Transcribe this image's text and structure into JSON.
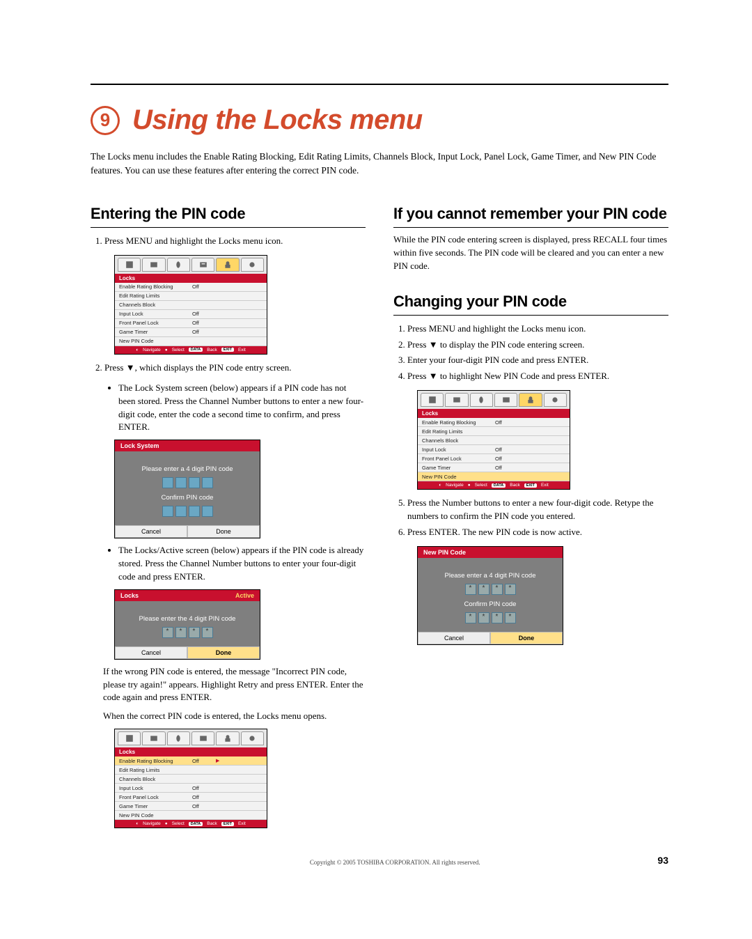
{
  "chapter": {
    "number": "9",
    "title": "Using the Locks menu"
  },
  "intro": "The Locks menu includes the Enable Rating Blocking, Edit Rating Limits, Channels Block, Input Lock, Panel Lock, Game Timer, and New PIN Code features. You can use these features after entering the correct PIN code.",
  "left": {
    "h1": "Entering the PIN code",
    "step1": "Press MENU and highlight the Locks menu icon.",
    "step2": "Press ▼, which displays the PIN code entry screen.",
    "bullet1": "The Lock System screen (below) appears if a PIN code has not been stored. Press the Channel Number buttons to enter a new four-digit code, enter the code a second time to confirm, and press ENTER.",
    "bullet2": "The Locks/Active screen (below) appears if the PIN code is already stored. Press the Channel Number buttons to enter your four-digit code and press ENTER.",
    "para1": "If the wrong PIN code is entered, the message \"Incorrect PIN code, please try again!\" appears. Highlight Retry and press ENTER. Enter the code again and press ENTER.",
    "para2": "When the correct PIN code is entered, the Locks menu opens."
  },
  "right": {
    "h1": "If you cannot remember your PIN code",
    "para1": "While the PIN code entering screen is displayed, press RECALL four times within five seconds. The PIN code will be cleared and you can enter a new PIN code.",
    "h2": "Changing your PIN code",
    "step1": "Press MENU and highlight the Locks menu icon.",
    "step2": "Press ▼ to display the PIN code entering screen.",
    "step3": "Enter your four-digit PIN code and press ENTER.",
    "step4": "Press ▼ to highlight New PIN Code and press ENTER.",
    "step5": "Press the Number buttons to enter a new four-digit code. Retype the numbers to confirm the PIN code you entered.",
    "step6": "Press ENTER. The new PIN code is now active."
  },
  "locks_menu": {
    "title": "Locks",
    "rows": [
      {
        "label": "Enable Rating Blocking",
        "value": "Off"
      },
      {
        "label": "Edit Rating Limits",
        "value": ""
      },
      {
        "label": "Channels Block",
        "value": ""
      },
      {
        "label": "Input Lock",
        "value": "Off"
      },
      {
        "label": "Front Panel Lock",
        "value": "Off"
      },
      {
        "label": "Game Timer",
        "value": "Off"
      },
      {
        "label": "New PIN Code",
        "value": ""
      }
    ],
    "nav": {
      "a": "Navigate",
      "b": "Select",
      "c": "Back",
      "d": "Exit",
      "chip1": "DATA",
      "chip2": "EXIT"
    }
  },
  "lock_system": {
    "title": "Lock System",
    "text1": "Please enter a 4 digit PIN code",
    "text2": "Confirm PIN code",
    "cancel": "Cancel",
    "done": "Done"
  },
  "locks_active": {
    "title": "Locks",
    "right": "Active",
    "text1": "Please enter the 4 digit PIN code",
    "cancel": "Cancel",
    "done": "Done"
  },
  "new_pin": {
    "title": "New PIN Code",
    "text1": "Please enter a 4 digit PIN code",
    "text2": "Confirm PIN code",
    "cancel": "Cancel",
    "done": "Done"
  },
  "footer": {
    "copy": "Copyright © 2005 TOSHIBA CORPORATION. All rights reserved.",
    "page": "93"
  }
}
